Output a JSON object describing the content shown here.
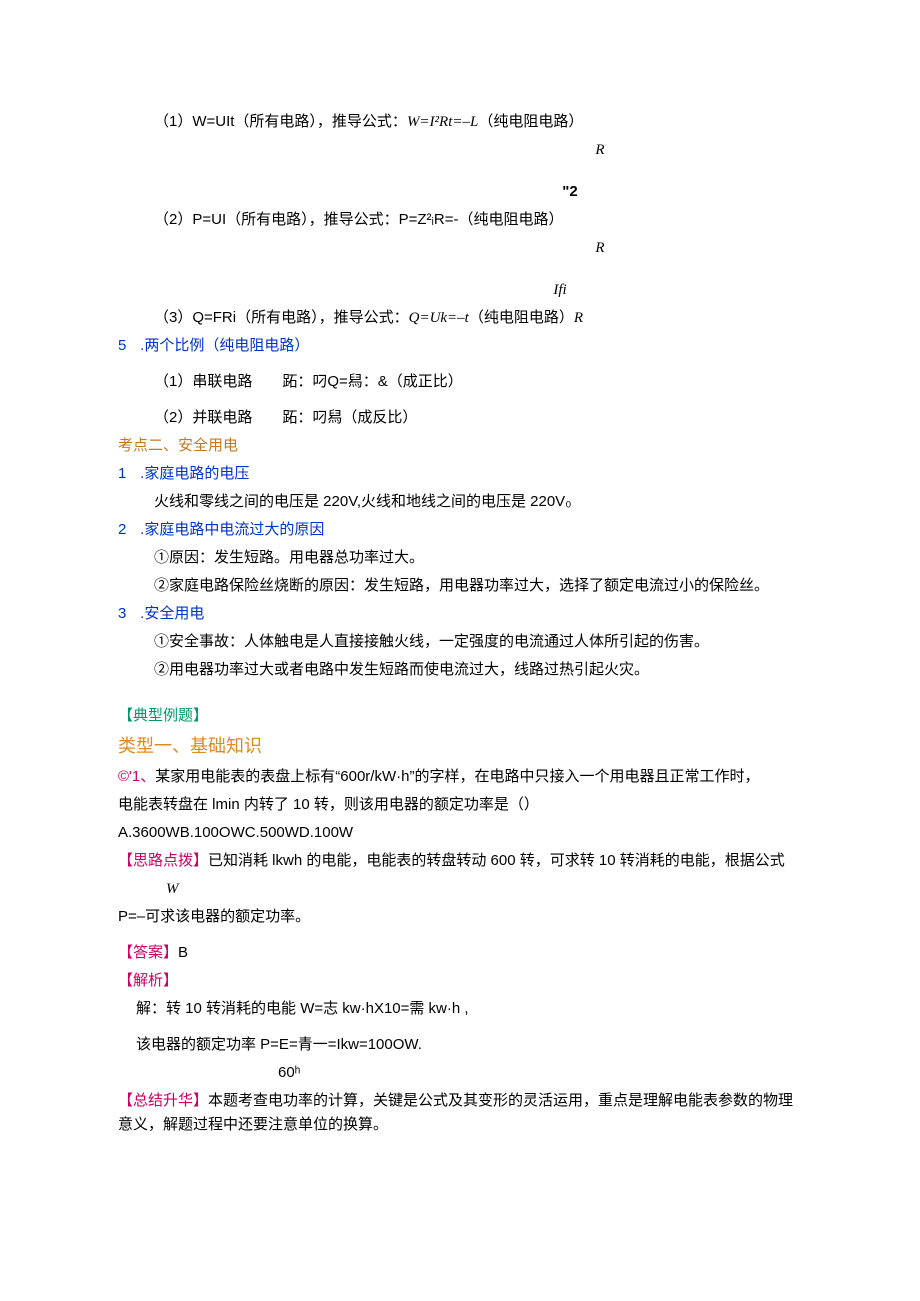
{
  "p1": {
    "line1_a": "（1）W=UIt（所有电路），推导公式：",
    "line1_b": "W=I²Rt=–L",
    "line1_c": "（纯电阻电路）",
    "line1_r": "R"
  },
  "p2": {
    "pre": "\"2",
    "line1_a": "（2）P=UI（所有电路），推导公式：P=Z²ᵢR=-（纯电阻电路）",
    "line1_r": "R"
  },
  "p3": {
    "pre": "Ifi",
    "line1_a": "（3）Q=FRi（所有电路），推导公式：",
    "line1_b": "Q=Uk=–t",
    "line1_c": "（纯电阻电路）",
    "line1_d": "R"
  },
  "sec5": {
    "num": "5",
    "title": ".两个比例（纯电阻电路）",
    "item1": "（1）串联电路　　跖：叼Q=舄：&（成正比）",
    "item2": "（2）并联电路　　跖：叼舄（成反比）"
  },
  "kd2": {
    "title": "考点二、安全用电",
    "s1": {
      "num": "1",
      "title": ".家庭电路的电压",
      "body": "火线和零线之间的电压是 220V,火线和地线之间的电压是 220V₀"
    },
    "s2": {
      "num": "2",
      "title": ".家庭电路中电流过大的原因",
      "b1": "①原因：发生短路。用电器总功率过大。",
      "b2": "②家庭电路保险丝烧断的原因：发生短路，用电器功率过大，选择了额定电流过小的保险丝。"
    },
    "s3": {
      "num": "3",
      "title": ".安全用电",
      "b1": "①安全事故：人体触电是人直接接触火线，一定强度的电流通过人体所引起的伤害。",
      "b2": "②用电器功率过大或者电路中发生短路而使电流过大，线路过热引起火灾。"
    }
  },
  "dx": {
    "title": "【典型例题】",
    "type1": "类型一、基础知识",
    "q1": {
      "tag": "©'1、",
      "q_a": "某家用电能表的表盘上标有“600r/kW·h”的字样，在电路中只接入一个用电器且正常工作时，",
      "q_b": "电能表转盘在 lmin 内转了 10 转，则该用电器的额定功率是（）",
      "opts": "A.3600WB.100OWC.500WD.100W",
      "sl_tag": "【思路点拨】",
      "sl_body": "已知消耗 lkwh 的电能，电能表的转盘转动 600 转，可求转 10 转消耗的电能，根据公式",
      "sl_w": "W",
      "sl_body2": "P=–可求该电器的额定功率。",
      "ans_tag": "【答案】",
      "ans_val": "B",
      "jx_tag": "【解析】",
      "jx1": "解：转 10 转消耗的电能 W=志 kw·hX10=需 kw·h ,",
      "jx2": "该电器的额定功率 P=E=青一=Ikw=100OW.",
      "jx2_sub": "60ʰ",
      "zj_tag": "【总结升华】",
      "zj_body": "本题考查电功率的计算，关键是公式及其变形的灵活运用，重点是理解电能表参数的物理意义，解题过程中还要注意单位的换算。"
    }
  }
}
